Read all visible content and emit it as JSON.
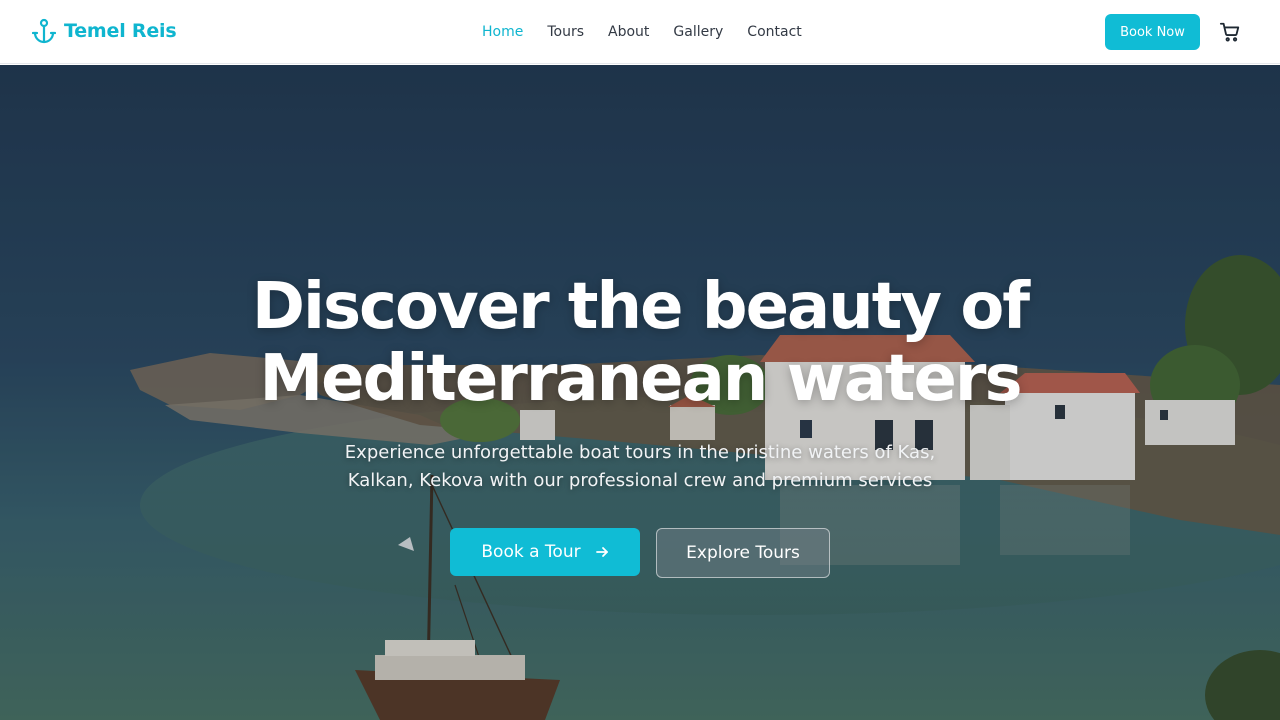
{
  "header": {
    "brand": "Temel Reis",
    "brand_icon": "anchor-icon",
    "nav": [
      {
        "label": "Home",
        "active": true
      },
      {
        "label": "Tours",
        "active": false
      },
      {
        "label": "About",
        "active": false
      },
      {
        "label": "Gallery",
        "active": false
      },
      {
        "label": "Contact",
        "active": false
      }
    ],
    "cta_label": "Book Now",
    "cart_icon": "shopping-cart-icon"
  },
  "hero": {
    "title_line1": "Discover the beauty of",
    "title_line2": "Mediterranean waters",
    "subtitle": "Experience unforgettable boat tours in the pristine waters of Kas, Kalkan, Kekova with our professional crew and premium services",
    "primary_label": "Book a Tour",
    "primary_icon": "arrow-right-icon",
    "secondary_label": "Explore Tours"
  },
  "colors": {
    "accent": "#10bcd5",
    "brand_text": "#0fb5cf",
    "nav_text": "#333a45"
  }
}
